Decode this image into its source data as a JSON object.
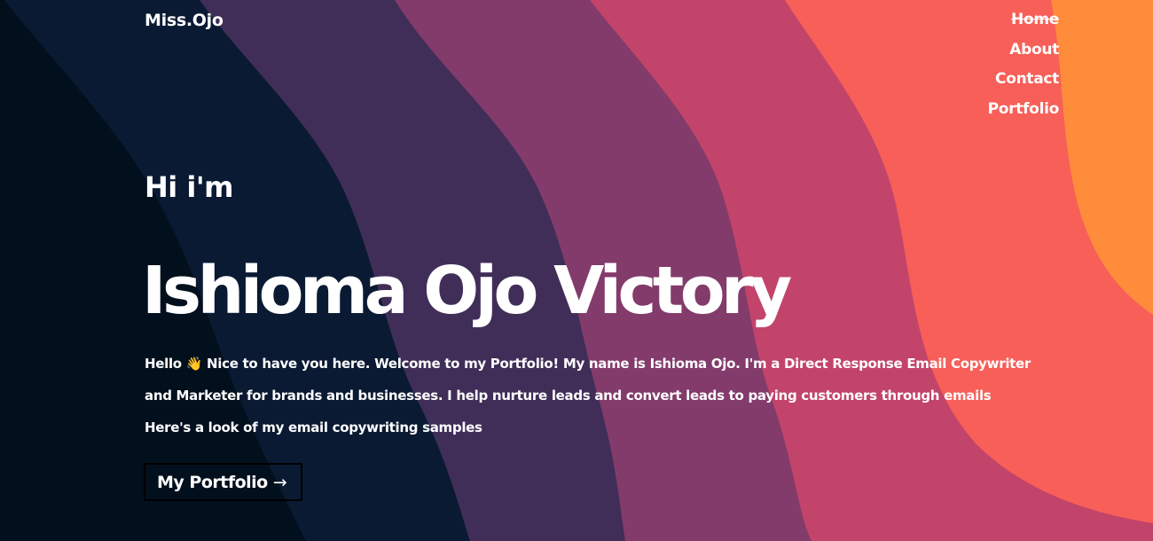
{
  "header": {
    "brand": "Miss.Ojo",
    "nav": [
      {
        "label": "Home",
        "active": true
      },
      {
        "label": "About",
        "active": false
      },
      {
        "label": "Contact",
        "active": false
      },
      {
        "label": "Portfolio",
        "active": false
      }
    ]
  },
  "hero": {
    "greeting": "Hi i'm",
    "name": "Ishioma Ojo Victory",
    "intro": "Hello 👋 Nice to have you here. Welcome to my Portfolio! My name is Ishioma Ojo. I'm a Direct Response Email Copywriter and Marketer for brands and businesses. I help nurture leads and convert leads to paying customers through emails Here's a look of my email copywriting samples",
    "cta_label": "My Portfolio",
    "cta_arrow": "→"
  },
  "theme": {
    "wave_colors": [
      "#020f1d",
      "#0a1a33",
      "#402e58",
      "#833b6b",
      "#c3446a",
      "#f75f58",
      "#ff8c3a"
    ],
    "text_color": "#ffffff",
    "cta_border": "#000000"
  }
}
